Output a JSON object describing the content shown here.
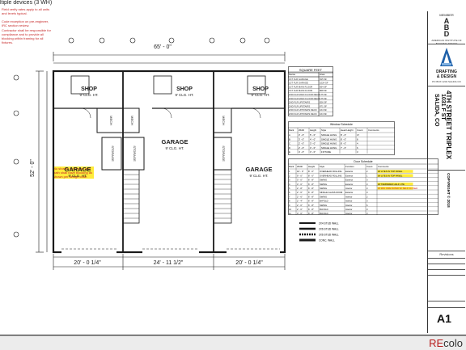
{
  "top_notes": {
    "strip": "ltiple devices (3 WH)",
    "red_1": "Field verify rates apply to all units and levels typical.",
    "red_2": "Code exception on pre-engineer, IRC section review.",
    "red_3": "Contractor shall be responsible for compliance and to provide all blocking within framing for all fixtures.",
    "red_4": "No shower on stream and bath shall have blocking as shown per design code."
  },
  "dimensions": {
    "overall_width": "65' - 0\"",
    "left_bay": "20' - 0 1/4\"",
    "center_bay": "24' - 11 1/2\"",
    "right_bay": "20' - 0 1/4\"",
    "overall_depth": "52' - 0\""
  },
  "rooms": {
    "shop_left": "SHOP",
    "shop_left_clg": "9' CLG. HT.",
    "shop_center": "SHOP",
    "shop_center_clg": "9' CLG. HT.",
    "shop_right": "SHOP",
    "shop_right_clg": "9' CLG. HT.",
    "garage_left": "GARAGE",
    "garage_left_clg": "9' CLG. HT.",
    "garage_center": "GARAGE",
    "garage_center_clg": "9' CLG. HT.",
    "garage_right": "GARAGE",
    "garage_right_clg": "9' CLG. HT.",
    "storage_1": "STORAGE",
    "storage_2": "STORAGE",
    "storage_3": "STORAGE",
    "mech_1": "MECH",
    "mech_2": "MECH",
    "mech_3": "MECH"
  },
  "square_feet": {
    "title": "SQUARE FEET",
    "headers": [
      "Name",
      "Area"
    ],
    "rows": [
      [
        "1ST FLR GARAGE",
        "815 SF"
      ],
      [
        "1ST FLR GARAGE",
        "1024 SF"
      ],
      [
        "1ST FLR MAIN FLOOR",
        "834 SF"
      ],
      [
        "1ST FLR MAIN FLOOR",
        "868 SF"
      ],
      [
        "2ND FLR MAIN FLOOR DECK",
        "175 SF"
      ],
      [
        "2ND FLR MAIN FLOOR DECK",
        "175 SF"
      ],
      [
        "2ND FLR UPSTAIRS",
        "826 SF"
      ],
      [
        "2ND FLR UPSTAIRS",
        "871 SF"
      ],
      [
        "2ND FLR UPSTAIRS DECK",
        "164 SF"
      ],
      [
        "2ND FLR UPSTAIRS DECK",
        "164 SF"
      ]
    ]
  },
  "window_schedule": {
    "title": "Window Schedule",
    "headers": [
      "Mark",
      "Width",
      "Height",
      "Style",
      "Head Height",
      "Count",
      "Comments"
    ],
    "rows": [
      [
        "A",
        "3' - 0\"",
        "5' - 0\"",
        "SINGLE HUNG",
        "8' - 0\"",
        "17",
        ""
      ],
      [
        "B",
        "3' - 0\"",
        "4' - 0\"",
        "SINGLE HUNG",
        "8' - 0\"",
        "8",
        ""
      ],
      [
        "C",
        "2' - 0\"",
        "3' - 0\"",
        "SINGLE HUNG",
        "8' - 0\"",
        "4",
        ""
      ],
      [
        "D",
        "2' - 0\"",
        "3' - 0\"",
        "SINGLE HUNG",
        "7' - 0\"",
        "6",
        ""
      ],
      [
        "E",
        "4' - 0\"",
        "3' - 0\"",
        "FIXTURE",
        "",
        "3",
        ""
      ]
    ]
  },
  "door_schedule": {
    "title": "Door Schedule",
    "headers": [
      "Mark",
      "Width",
      "Height",
      "Style",
      "Function",
      "Count",
      "Comments"
    ],
    "rows": [
      [
        "1",
        "16' - 0\"",
        "8' - 0\"",
        "OVERHEAD ROLLING",
        "Exterior",
        "2",
        "W/ LITES IN TOP PANEL"
      ],
      [
        "2",
        "9' - 0\"",
        "8' - 0\"",
        "OVERHEAD ROLLING",
        "Exterior",
        "1",
        "W/ LITES IN TOP PANEL"
      ],
      [
        "3",
        "3' - 0\"",
        "6' - 8\"",
        "SWING",
        "Exterior",
        "3",
        ""
      ],
      [
        "4",
        "3' - 0\"",
        "6' - 8\"",
        "SWING",
        "Exterior",
        "3",
        "W/ TEMPERED HALF LITE"
      ],
      [
        "5",
        "2' - 8\"",
        "6' - 8\"",
        "SWING",
        "Interior",
        "3",
        "20 MIN. FIRE RATED W/ SELF CLOSER"
      ],
      [
        "6",
        "2' - 6\"",
        "6' - 8\"",
        "SINGLE GLASS DOOR",
        "Exterior",
        "3",
        ""
      ],
      [
        "7",
        "2' - 6\"",
        "6' - 8\"",
        "SWING",
        "Interior",
        "2",
        ""
      ],
      [
        "8",
        "2' - 4\"",
        "6' - 8\"",
        "BI-FOLD",
        "Interior",
        "3",
        ""
      ],
      [
        "9",
        "2' - 0\"",
        "6' - 8\"",
        "SWING",
        "Interior",
        "6",
        ""
      ],
      [
        "10",
        "2' - 0\"",
        "6' - 8\"",
        "BI-FOLD",
        "Interior",
        "3",
        ""
      ],
      [
        "11",
        "3' - 0\"",
        "6' - 8\"",
        "BI-FOLD",
        "Interior",
        "3",
        ""
      ]
    ]
  },
  "legend": {
    "line_1": "2X4 STUD WALL",
    "line_2": "2X6 STUD WALL",
    "line_3": "2X6 STUD WALL",
    "line_4": "CONC. WALL"
  },
  "title_block": {
    "member": "MEMBER",
    "abd_line1": "A",
    "abd_line2": "B",
    "abd_line3": "D",
    "org": "AMERICAN INSTITUTE OF BUILDING DESIGN",
    "firm_line1": "DRAFTING",
    "firm_line2": "& DESIGN",
    "firm_contact": "PO BOX 1234 SALIDA CO",
    "project_1": "4TH STREET TRIPLEX",
    "project_2": "1031 F ST",
    "project_3": "SALIDA, CO",
    "copyright": "COPYRIGHT © 2018",
    "revisions": "Revisions",
    "sheet_no": "A1"
  },
  "footer": {
    "logo_prefix": "RE",
    "logo_suffix": "colo"
  },
  "colors": {
    "line": "#1a1a1a",
    "red_note": "#c62828",
    "highlight": "#ffeb3b",
    "brand_blue": "#1d5fa8"
  }
}
